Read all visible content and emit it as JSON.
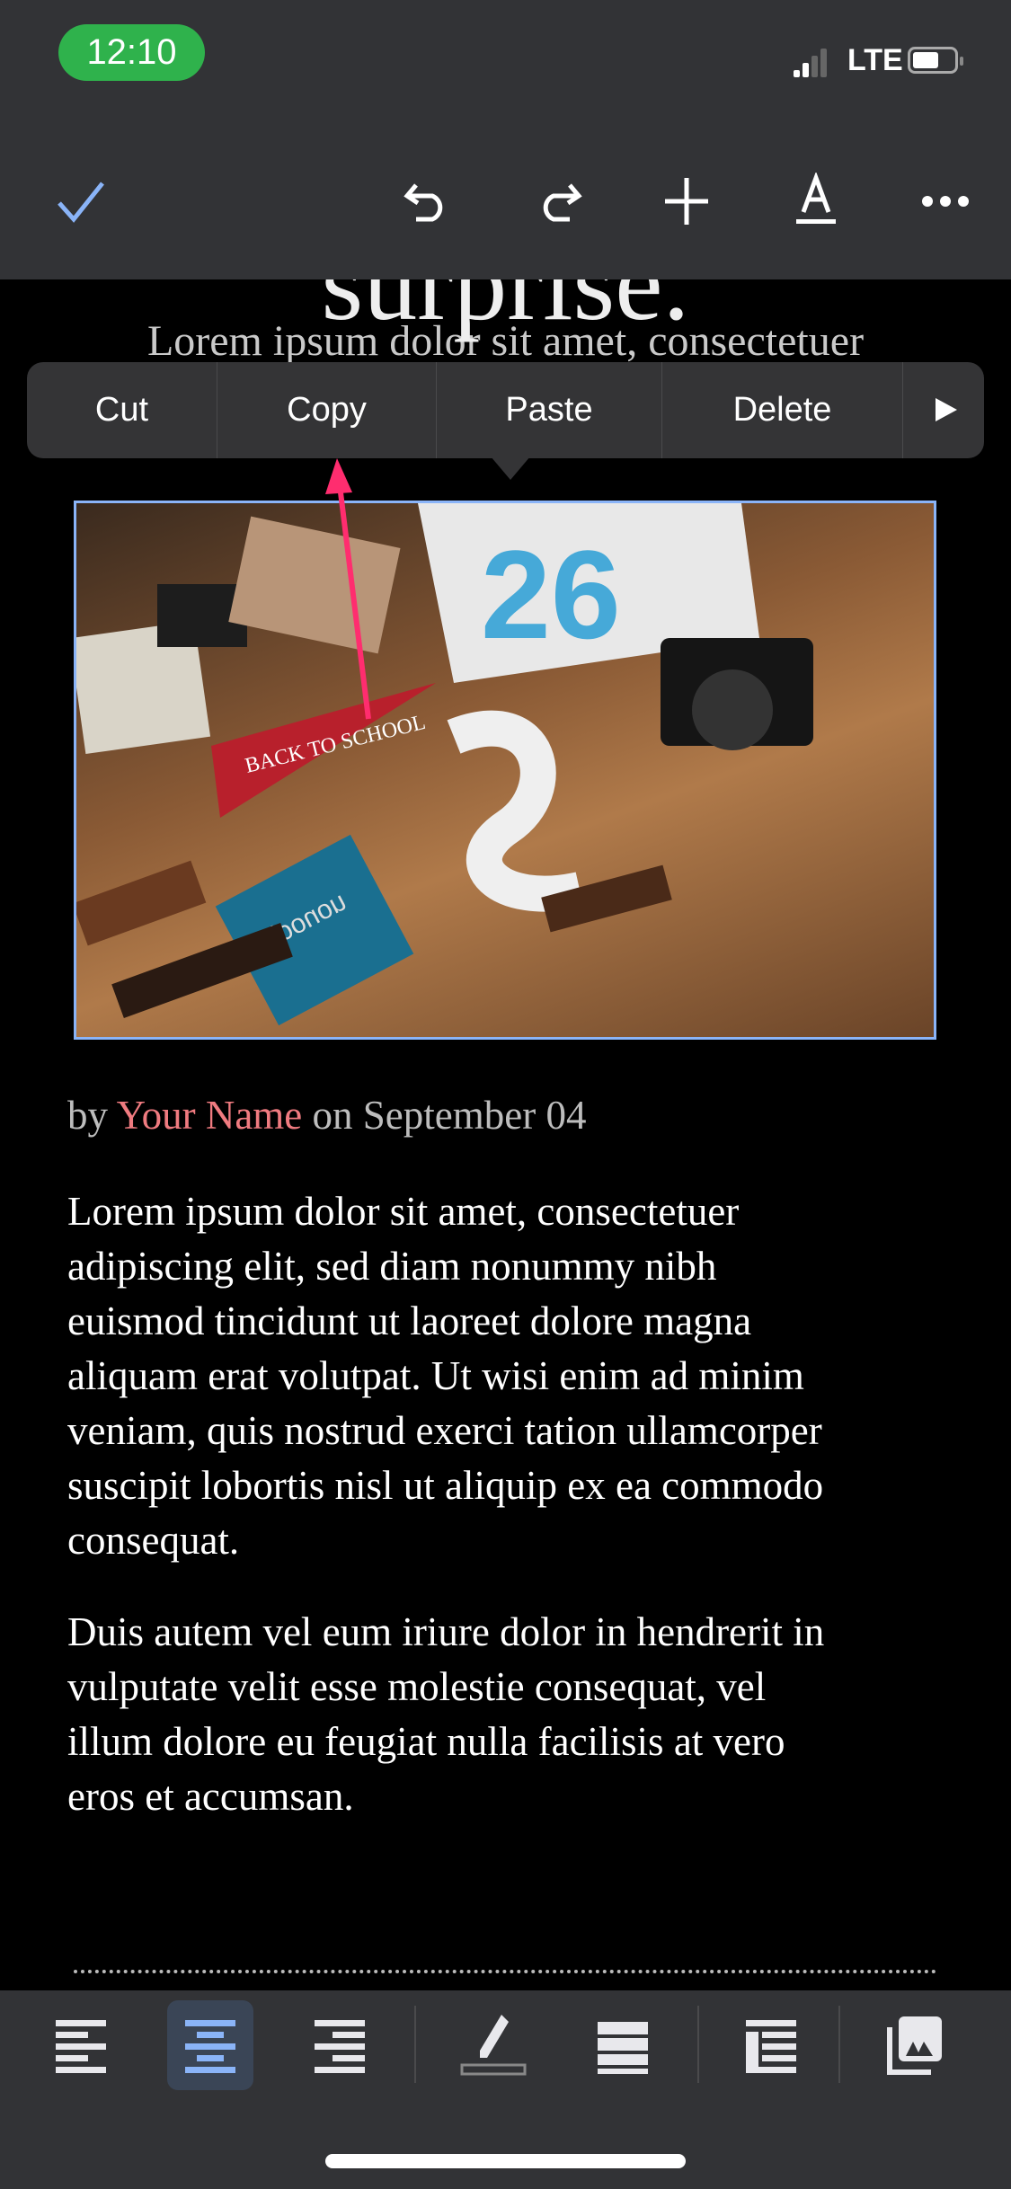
{
  "status_bar": {
    "time": "12:10",
    "network": "LTE",
    "battery_level_pct": 60
  },
  "toolbar": {
    "icons": [
      "check-icon",
      "undo-icon",
      "redo-icon",
      "plus-icon",
      "text-format-icon",
      "more-icon"
    ],
    "accent": "#8ab4f8"
  },
  "document": {
    "title_fragment": "surprise.",
    "subtitle": "Lorem ipsum dolor sit amet, consectetuer",
    "byline": {
      "prefix": "by",
      "author": "Your Name",
      "suffix": "on September 04"
    },
    "paragraphs": [
      [
        "Lorem ipsum dolor sit amet, consectetuer",
        "adipiscing elit, sed diam nonummy nibh",
        "euismod tincidunt ut laoreet dolore magna",
        "aliquam erat volutpat. Ut wisi enim ad minim",
        "veniam, quis nostrud exerci tation ullamcorper",
        "suscipit lobortis nisl ut aliquip ex ea commodo",
        "consequat."
      ],
      [
        "Duis autem vel eum iriure dolor in hendrerit in",
        "vulputate velit esse molestie consequat, vel",
        "illum dolore eu feugiat nulla facilisis at vero",
        "eros et accumsan."
      ]
    ]
  },
  "context_menu": {
    "items": [
      "Cut",
      "Copy",
      "Paste",
      "Delete"
    ],
    "more_icon": "triangle-right-icon"
  },
  "image": {
    "pennant_text": "BACK TO SCHOOL",
    "box_text": "uonock"
  },
  "bottom_toolbar": {
    "icons": [
      "align-left-icon",
      "align-center-icon",
      "align-right-icon",
      "highlight-pen-icon",
      "line-spacing-icon",
      "indent-icon",
      "image-icon"
    ],
    "selected": "align-center-icon"
  },
  "annotation_color": "#ff2d6f"
}
